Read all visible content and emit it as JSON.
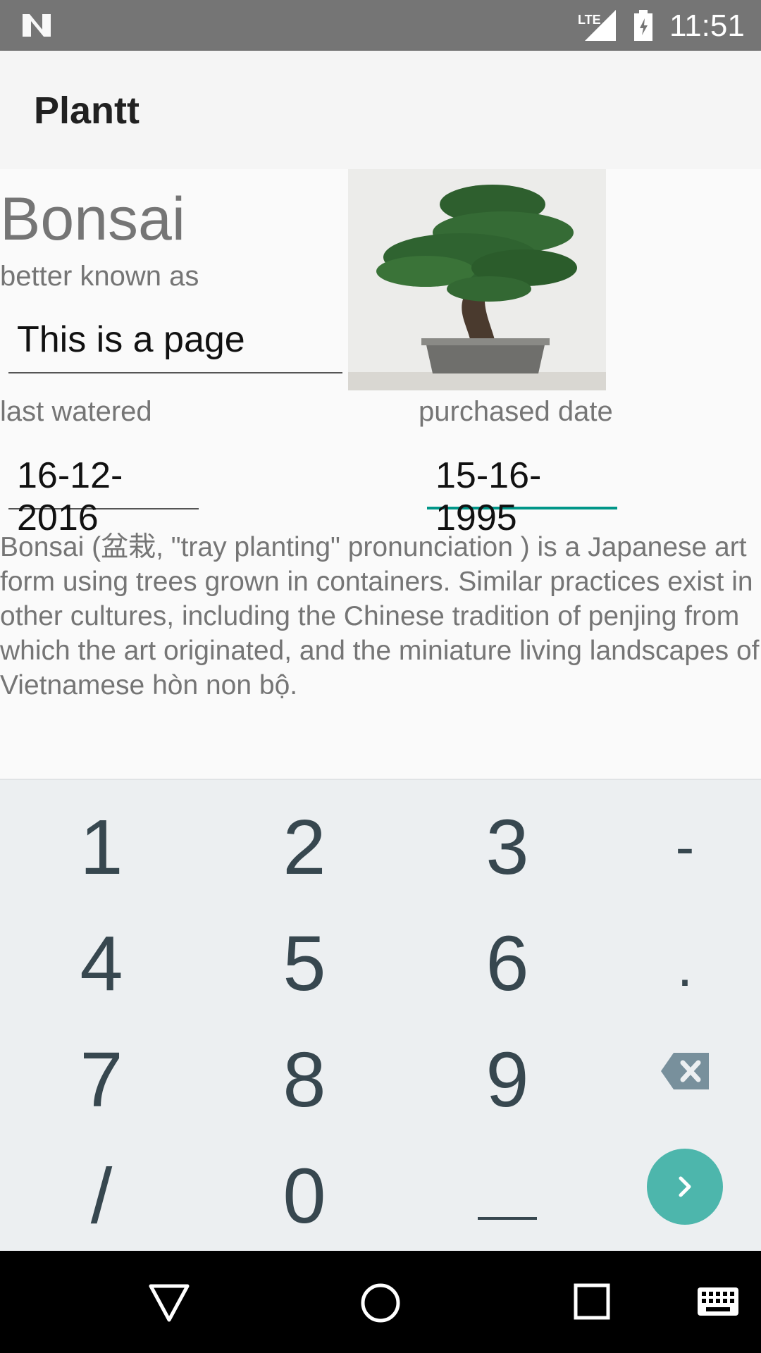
{
  "status_bar": {
    "time": "11:51",
    "network": "LTE",
    "icons": [
      "n-logo-icon",
      "lte-signal-icon",
      "battery-charging-icon"
    ]
  },
  "app_bar": {
    "title": "Plantt"
  },
  "plant": {
    "name": "Bonsai",
    "subtitle": "better known as",
    "nickname": "This is a page",
    "last_watered_label": "last watered",
    "last_watered": "16-12-2016",
    "purchased_label": "purchased date",
    "purchased": "15-16-1995",
    "description": "Bonsai (盆栽, \"tray planting\"  pronunciation ) is a Japanese art form using trees grown in containers. Similar practices exist in other cultures, including the Chinese tradition of penjing from which the art originated, and the miniature living landscapes of Vietnamese hòn non bộ."
  },
  "keyboard": {
    "keys": [
      "1",
      "2",
      "3",
      "-",
      "4",
      "5",
      "6",
      ".",
      "7",
      "8",
      "9",
      "/",
      "0"
    ],
    "special": [
      "backspace-icon",
      "underscore-key",
      "go-arrow-icon"
    ]
  },
  "nav_bar": {
    "icons": [
      "back-icon",
      "home-icon",
      "recents-icon",
      "keyboard-icon"
    ]
  },
  "colors": {
    "accent": "#009688",
    "keyboard_go": "#4db6ac",
    "status_bar": "#757575",
    "key_text": "#37474f"
  }
}
